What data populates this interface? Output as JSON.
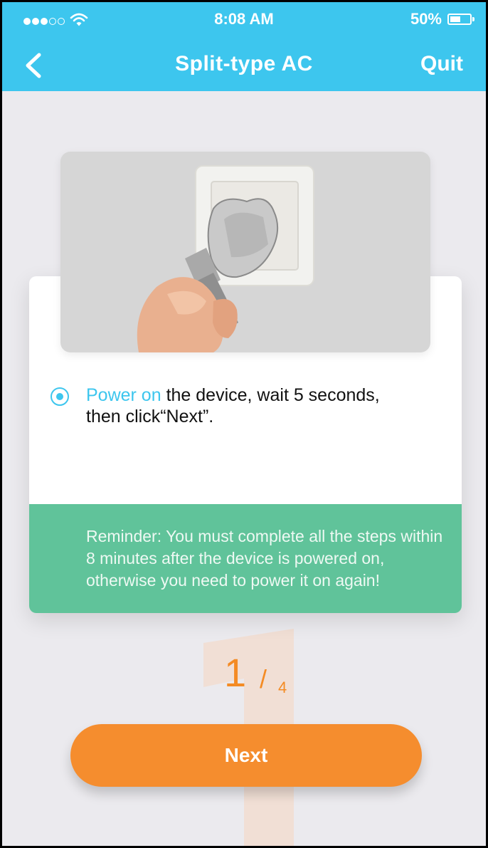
{
  "status_bar": {
    "time": "8:08 AM",
    "battery": "50%",
    "signal_bars_filled": 3,
    "signal_bars_total": 5
  },
  "nav": {
    "title": "Split-type AC",
    "quit_label": "Quit"
  },
  "instruction": {
    "highlight": "Power on",
    "text_line1": " the device, wait 5 seconds,",
    "text_line2": "then click“Next”."
  },
  "reminder": {
    "text": "Reminder: You must complete all the steps within 8 minutes after the device is powered on, otherwise you need to power it on again!"
  },
  "step": {
    "current": "1",
    "separator": "/",
    "total": "4"
  },
  "next_button": {
    "label": "Next"
  },
  "colors": {
    "header": "#3dc6ee",
    "accent": "#3dc6ee",
    "reminder_bg": "#60c39a",
    "button": "#f58d2e",
    "step_number": "#f48b24"
  },
  "icons": [
    "wifi-icon",
    "battery-icon",
    "back-chevron-icon",
    "radio-selected-icon"
  ]
}
